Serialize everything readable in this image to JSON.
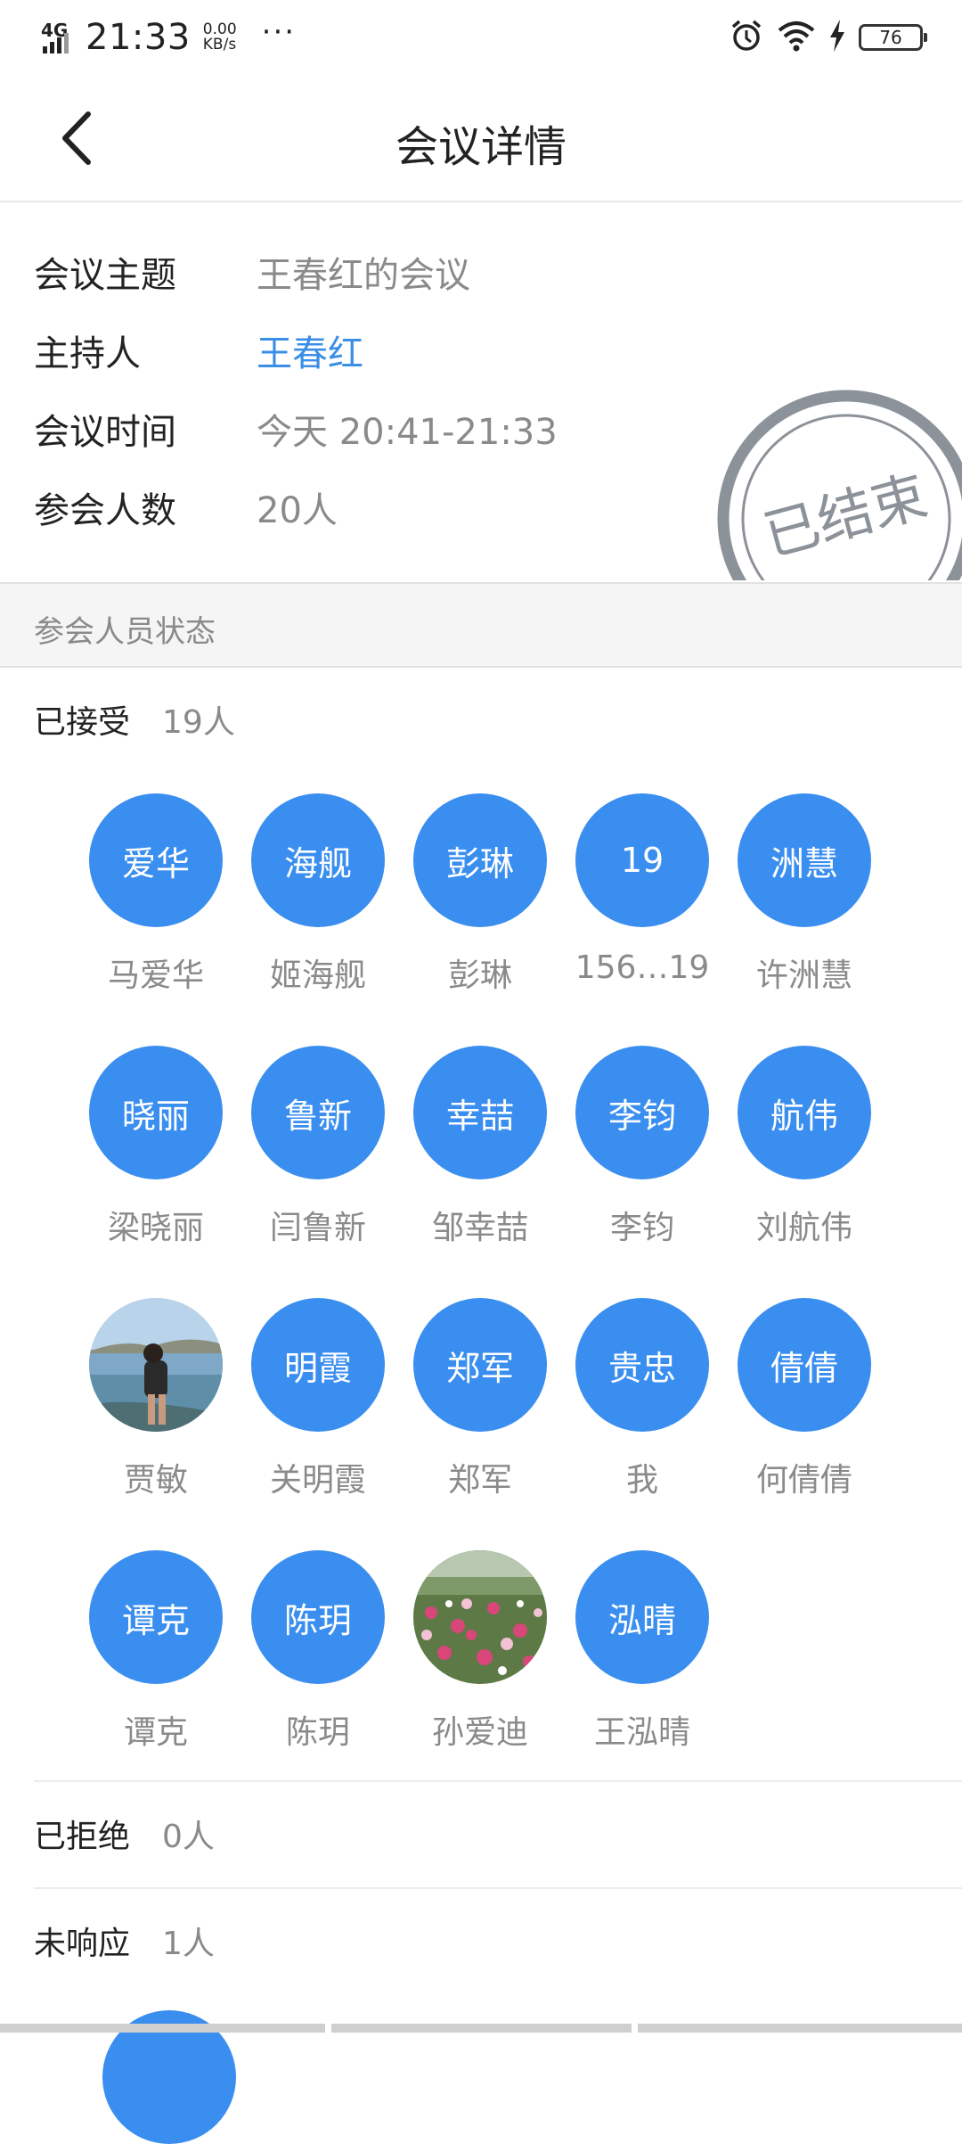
{
  "status_bar": {
    "network": "4G",
    "time": "21:33",
    "speed_value": "0.00",
    "speed_unit": "KB/s",
    "more": "···",
    "battery": "76"
  },
  "navbar": {
    "title": "会议详情",
    "back_icon": "chevron-left-icon"
  },
  "info": {
    "topic_label": "会议主题",
    "topic_value": "王春红的会议",
    "host_label": "主持人",
    "host_value": "王春红",
    "time_label": "会议时间",
    "time_value": "今天 20:41-21:33",
    "count_label": "参会人数",
    "count_value": "20人",
    "stamp_text": "已结束"
  },
  "section_header": "参会人员状态",
  "accepted": {
    "label": "已接受",
    "count": "19人",
    "members": [
      {
        "avatar": "爱华",
        "name": "马爱华"
      },
      {
        "avatar": "海舰",
        "name": "姬海舰"
      },
      {
        "avatar": "彭琳",
        "name": "彭琳"
      },
      {
        "avatar": "19",
        "name": "156…19"
      },
      {
        "avatar": "洲慧",
        "name": "许洲慧"
      },
      {
        "avatar": "晓丽",
        "name": "梁晓丽"
      },
      {
        "avatar": "鲁新",
        "name": "闫鲁新"
      },
      {
        "avatar": "幸喆",
        "name": "邹幸喆"
      },
      {
        "avatar": "李钧",
        "name": "李钧"
      },
      {
        "avatar": "航伟",
        "name": "刘航伟"
      },
      {
        "avatar": "",
        "name": "贾敏",
        "photo": "beach"
      },
      {
        "avatar": "明霞",
        "name": "关明霞"
      },
      {
        "avatar": "郑军",
        "name": "郑军"
      },
      {
        "avatar": "贵忠",
        "name": "我"
      },
      {
        "avatar": "倩倩",
        "name": "何倩倩"
      },
      {
        "avatar": "谭克",
        "name": "谭克"
      },
      {
        "avatar": "陈玥",
        "name": "陈玥"
      },
      {
        "avatar": "",
        "name": "孙爱迪",
        "photo": "flowers"
      },
      {
        "avatar": "泓晴",
        "name": "王泓晴"
      }
    ]
  },
  "rejected": {
    "label": "已拒绝",
    "count": "0人"
  },
  "no_response": {
    "label": "未响应",
    "count": "1人"
  },
  "colors": {
    "accent": "#3a8ef0",
    "link": "#3a8ee6",
    "text_primary": "#222222",
    "text_secondary": "#8a8a8a",
    "section_bg": "#f5f5f5"
  }
}
